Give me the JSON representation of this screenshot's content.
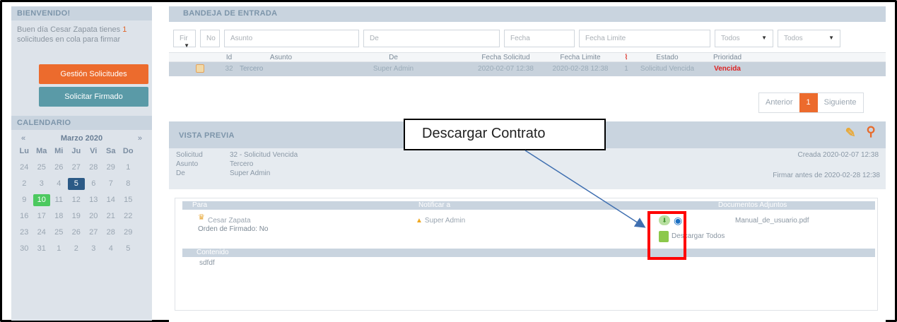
{
  "sidebar": {
    "welcome": {
      "title": "BIENVENIDO!",
      "text_before": "Buen día Cesar Zapata tienes ",
      "count": "1",
      "text_after": " solicitudes en cola para firmar"
    },
    "buttons": {
      "gestion": "Gestión Solicitudes",
      "solicitar": "Solicitar Firmado"
    },
    "calendar": {
      "title": "CALENDARIO",
      "prev": "«",
      "month": "Marzo 2020",
      "next": "»",
      "dow": [
        "Lu",
        "Ma",
        "Mi",
        "Ju",
        "Vi",
        "Sa",
        "Do"
      ],
      "weeks": [
        [
          "24",
          "25",
          "26",
          "27",
          "28",
          "29",
          "1"
        ],
        [
          "2",
          "3",
          "4",
          "5",
          "6",
          "7",
          "8"
        ],
        [
          "9",
          "10",
          "11",
          "12",
          "13",
          "14",
          "15"
        ],
        [
          "16",
          "17",
          "18",
          "19",
          "20",
          "21",
          "22"
        ],
        [
          "23",
          "24",
          "25",
          "26",
          "27",
          "28",
          "29"
        ],
        [
          "30",
          "31",
          "1",
          "2",
          "3",
          "4",
          "5"
        ]
      ],
      "selected_day": "5",
      "today": "10"
    }
  },
  "inbox": {
    "title": "BANDEJA DE ENTRADA",
    "filters": {
      "fir": "Fir",
      "no": "No",
      "asunto": "Asunto",
      "de": "De",
      "fecha": "Fecha",
      "fecha_limite": "Fecha Limite",
      "estado": "Todos",
      "prioridad": "Todos"
    },
    "columns": [
      "",
      "Id",
      "Asunto",
      "De",
      "Fecha Solicitud",
      "Fecha Limite",
      "",
      "Estado",
      "Prioridad"
    ],
    "row": {
      "id": "32",
      "asunto": "Tercero",
      "de": "Super Admin",
      "fecha_solicitud": "2020-02-07 12:38",
      "fecha_limite": "2020-02-28 12:38",
      "adjuntos": "1",
      "estado": "Solicitud Vencida",
      "prioridad": "Vencida"
    },
    "pager": {
      "prev": "Anterior",
      "current": "1",
      "next": "Siguiente"
    }
  },
  "preview": {
    "title": "VISTA PREVIA",
    "solicitud_label": "Solicitud",
    "solicitud_value": "32 - Solicitud Vencida",
    "asunto_label": "Asunto",
    "asunto_value": "Tercero",
    "de_label": "De",
    "de_value": "Super Admin",
    "creada": "Creada 2020-02-07 12:38",
    "firmar_antes": "Firmar antes de 2020-02-28 12:38",
    "sections": {
      "para": "Para",
      "notificar": "Notificar a",
      "documentos": "Documentos Adjuntos",
      "contenido": "Contenido"
    },
    "para_name": "Cesar Zapata",
    "orden": "Orden de Firmado: No",
    "notificar_name": "Super Admin",
    "file_name": "Manual_de_usuario.pdf",
    "descargar_todos": "Descargar Todos",
    "contenido_text": "sdfdf"
  },
  "callout": {
    "text": "Descargar Contrato"
  }
}
